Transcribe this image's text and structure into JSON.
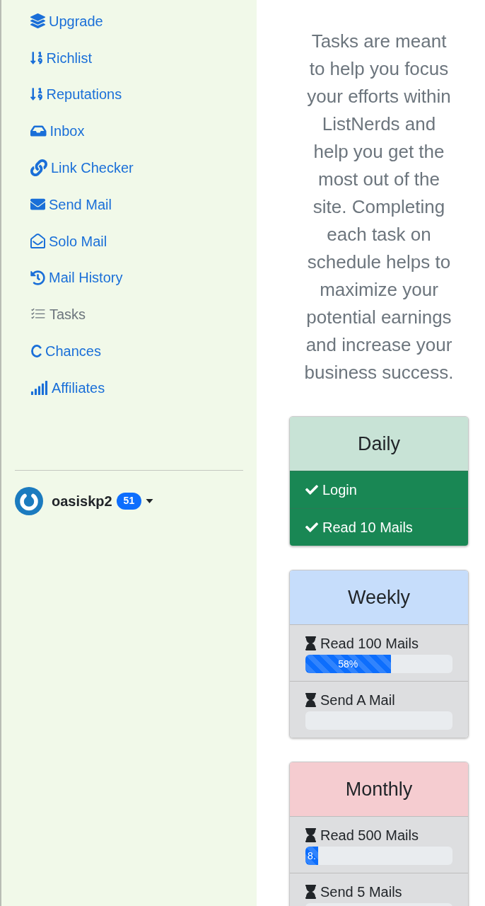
{
  "sidebar": {
    "items": [
      {
        "label": "Upgrade",
        "selected": false
      },
      {
        "label": "Richlist",
        "selected": false
      },
      {
        "label": "Reputations",
        "selected": false
      },
      {
        "label": "Inbox",
        "selected": false
      },
      {
        "label": "Link Checker",
        "selected": false
      },
      {
        "label": "Send Mail",
        "selected": false
      },
      {
        "label": "Solo Mail",
        "selected": false
      },
      {
        "label": "Mail History",
        "selected": false
      },
      {
        "label": "Tasks",
        "selected": true
      },
      {
        "label": "Chances",
        "selected": false
      },
      {
        "label": "Affiliates",
        "selected": false
      }
    ],
    "user": {
      "name": "oasiskp2",
      "badge": "51"
    }
  },
  "intro": "Tasks are meant to help you focus your efforts within ListNerds and help you get the most out of the site. Completing each task on schedule helps to maximize your potential earnings and increase your business success.",
  "task_groups": [
    {
      "title": "Daily",
      "color": "#c8e3d6",
      "tasks": [
        {
          "label": "Login",
          "completed": true
        },
        {
          "label": "Read 10 Mails",
          "completed": true
        }
      ]
    },
    {
      "title": "Weekly",
      "color": "#c6ddfb",
      "tasks": [
        {
          "label": "Read 100 Mails",
          "completed": false,
          "level": 0.58,
          "reading": "58%"
        },
        {
          "label": "Send A Mail",
          "completed": false
        }
      ]
    },
    {
      "title": "Monthly",
      "color": "#f5ccd0",
      "tasks": [
        {
          "label": "Read 500 Mails",
          "completed": false,
          "level": 0.086,
          "reading": "8."
        },
        {
          "label": "Send 5 Mails",
          "completed": false
        }
      ]
    }
  ]
}
